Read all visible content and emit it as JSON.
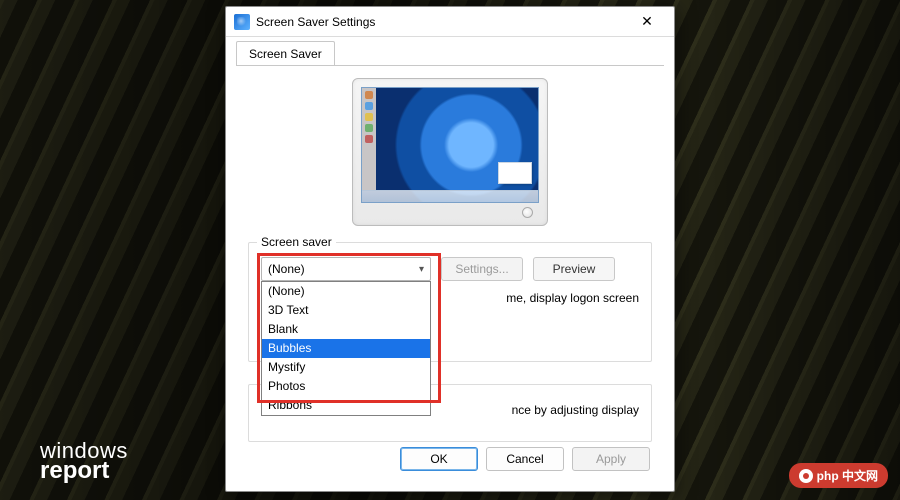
{
  "window": {
    "title": "Screen Saver Settings",
    "close_glyph": "✕"
  },
  "tab": {
    "label": "Screen Saver"
  },
  "group1": {
    "legend": "Screen saver",
    "combo_value": "(None)",
    "settings_btn": "Settings...",
    "preview_btn": "Preview",
    "hint_tail": "me, display logon screen",
    "options": [
      "(None)",
      "3D Text",
      "Blank",
      "Bubbles",
      "Mystify",
      "Photos",
      "Ribbons"
    ],
    "selected_option": "Bubbles"
  },
  "group2": {
    "hint_tail": "nce by adjusting display"
  },
  "footer": {
    "ok": "OK",
    "cancel": "Cancel",
    "apply": "Apply"
  },
  "watermarks": {
    "wr1": "windows",
    "wr2": "report",
    "php": "php 中文网"
  }
}
